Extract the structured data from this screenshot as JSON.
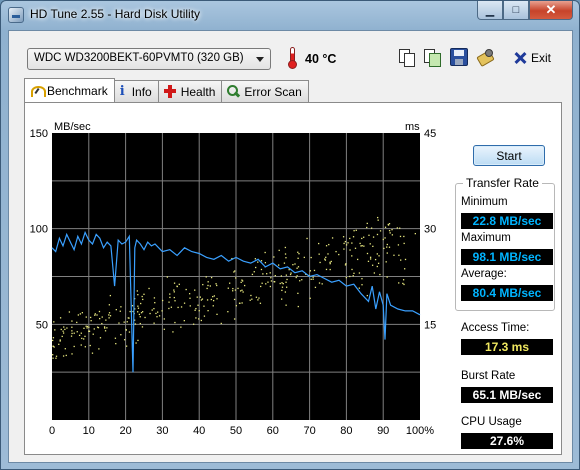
{
  "window": {
    "title": "HD Tune 2.55 - Hard Disk Utility",
    "controls": {
      "minimize": "▁",
      "maximize": "□",
      "close": "✕"
    }
  },
  "toolbar": {
    "drive": "WDC WD3200BEKT-60PVMT0 (320 GB)",
    "temperature": "40 °C",
    "exit_label": "Exit"
  },
  "tabs": [
    {
      "label": "Benchmark",
      "icon": "gauge-icon"
    },
    {
      "label": "Info",
      "icon": "info-icon"
    },
    {
      "label": "Health",
      "icon": "health-cross-icon"
    },
    {
      "label": "Error Scan",
      "icon": "magnifier-icon"
    }
  ],
  "benchmark": {
    "start_label": "Start",
    "transfer_rate_title": "Transfer Rate",
    "minimum_label": "Minimum",
    "minimum_value": "22.8 MB/sec",
    "maximum_label": "Maximum",
    "maximum_value": "98.1 MB/sec",
    "average_label": "Average:",
    "average_value": "80.4 MB/sec",
    "access_time_label": "Access Time:",
    "access_time_value": "17.3 ms",
    "burst_rate_label": "Burst Rate",
    "burst_rate_value": "65.1 MB/sec",
    "cpu_usage_label": "CPU Usage",
    "cpu_usage_value": "27.6%"
  },
  "colors": {
    "transfer_line": "#3aa0ff",
    "access_points": "#e8e880",
    "plot_bg": "#000000",
    "grid": "#808080"
  },
  "chart_data": {
    "type": "line",
    "ylabel": "MB/sec",
    "y2label": "ms",
    "ylim": [
      0,
      150
    ],
    "y2lim": [
      0,
      45
    ],
    "xlim": [
      0,
      100
    ],
    "xticks": [
      "0",
      "10",
      "20",
      "30",
      "40",
      "50",
      "60",
      "70",
      "80",
      "90",
      "100%"
    ],
    "yticks": [
      "150",
      "100",
      "50"
    ],
    "y2ticks": [
      "45",
      "30",
      "15"
    ],
    "grid": true,
    "series": [
      {
        "kind": "line",
        "axis": "left",
        "x": [
          0,
          1,
          2,
          3,
          4,
          5,
          6,
          7,
          8,
          9,
          10,
          11,
          12,
          13,
          14,
          15,
          16,
          17,
          18,
          19,
          20,
          21,
          22,
          22.5,
          23,
          24,
          25,
          26,
          27,
          28,
          29,
          30,
          32,
          34,
          36,
          38,
          40,
          42,
          44,
          46,
          48,
          50,
          52,
          54,
          56,
          58,
          60,
          62,
          64,
          66,
          68,
          70,
          72,
          74,
          76,
          78,
          80,
          82,
          84,
          86,
          87,
          88,
          89,
          90,
          90.5,
          91,
          92,
          94,
          96,
          98,
          100
        ],
        "y": [
          90,
          88,
          95,
          91,
          97,
          93,
          89,
          96,
          92,
          98,
          94,
          92,
          97,
          95,
          90,
          93,
          91,
          70,
          94,
          92,
          93,
          96,
          25,
          90,
          94,
          92,
          89,
          93,
          91,
          92,
          90,
          88,
          89,
          86,
          90,
          88,
          87,
          85,
          84,
          86,
          83,
          85,
          83,
          82,
          84,
          80,
          82,
          79,
          80,
          77,
          78,
          75,
          76,
          74,
          72,
          73,
          70,
          71,
          66,
          62,
          70,
          58,
          67,
          60,
          42,
          66,
          60,
          58,
          57,
          57,
          55
        ]
      },
      {
        "kind": "scatter",
        "axis": "right",
        "note": "random access time samples",
        "x_range": [
          0,
          100
        ],
        "y_range": [
          12,
          33
        ]
      }
    ]
  }
}
